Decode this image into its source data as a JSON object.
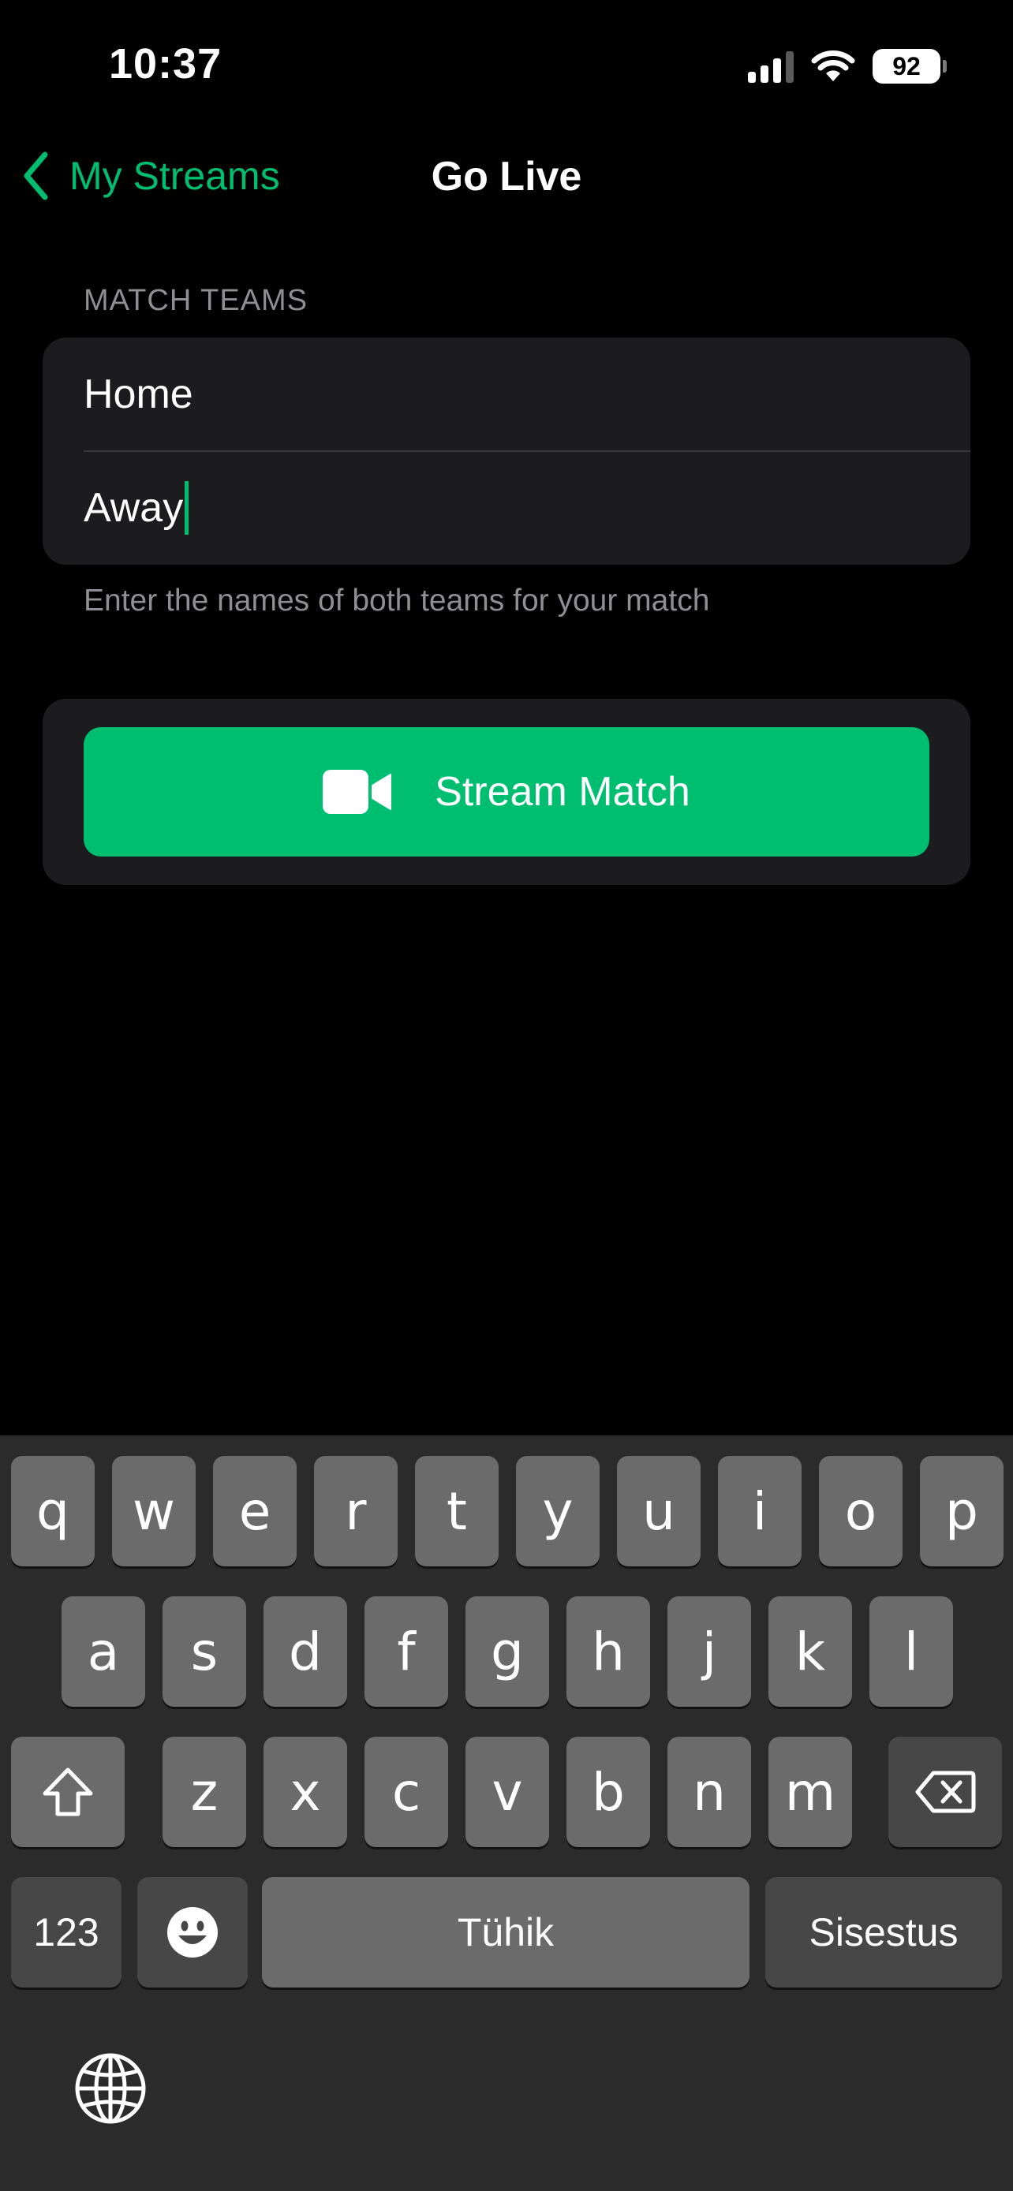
{
  "status_bar": {
    "time": "10:37",
    "battery_level": "92",
    "signal_bars_active": 3,
    "signal_bars_total": 4,
    "icons": [
      "cellular-signal-icon",
      "wifi-icon",
      "battery-icon"
    ]
  },
  "nav": {
    "back_label": "My Streams",
    "title": "Go Live",
    "back_icon": "chevron-left-icon"
  },
  "form": {
    "section_header": "MATCH TEAMS",
    "home_value": "Home",
    "away_value": "Away",
    "focused_field": "away",
    "section_footer": "Enter the names of both teams for your match"
  },
  "stream_button": {
    "label": "Stream Match",
    "icon": "video-camera-icon"
  },
  "keyboard": {
    "row1": [
      "q",
      "w",
      "e",
      "r",
      "t",
      "y",
      "u",
      "i",
      "o",
      "p"
    ],
    "row2": [
      "a",
      "s",
      "d",
      "f",
      "g",
      "h",
      "j",
      "k",
      "l"
    ],
    "row3": [
      "z",
      "x",
      "c",
      "v",
      "b",
      "n",
      "m"
    ],
    "numbers_label": "123",
    "space_label": "Tühik",
    "return_label": "Sisestus",
    "icons": [
      "shift-icon",
      "delete-icon",
      "emoji-icon",
      "globe-icon"
    ]
  },
  "colors": {
    "accent": "#00be70",
    "background": "#000000",
    "group_background": "#1c1c1e",
    "secondary_text": "#8e8e93",
    "keyboard_background": "#2b2b2b",
    "key_background": "#6b6b6b",
    "special_key_background": "#474747"
  }
}
